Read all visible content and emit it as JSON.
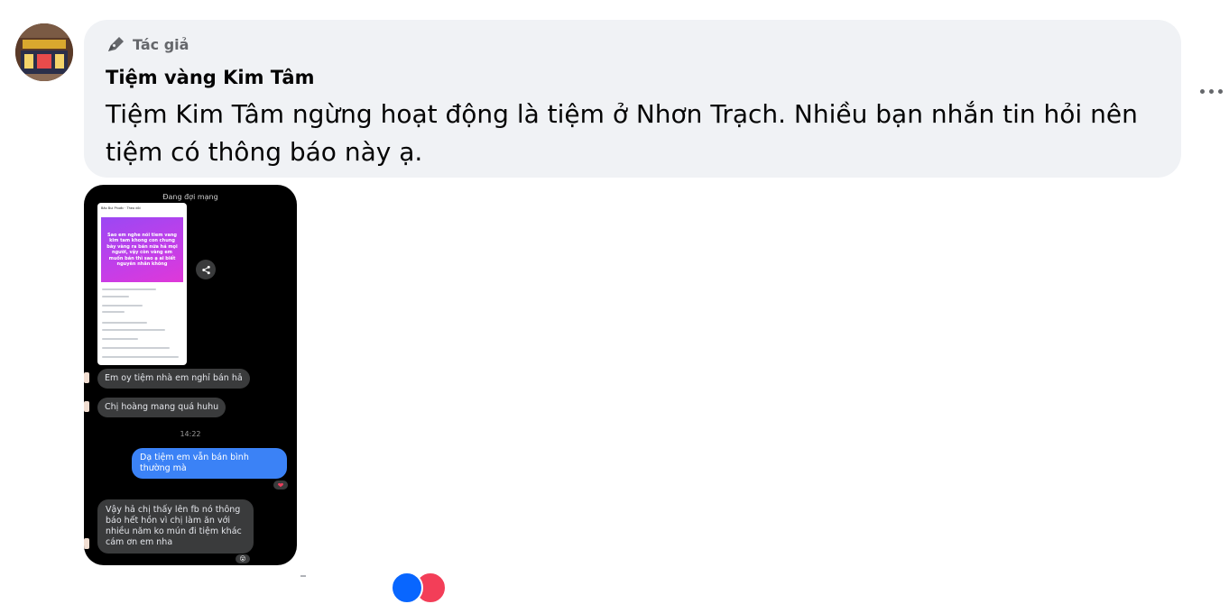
{
  "comment": {
    "badge_label": "Tác giả",
    "author_name": "Tiệm vàng Kim Tâm",
    "message": "Tiệm Kim Tâm ngừng hoạt động là tiệm ở Nhơn Trạch. Nhiều bạn nhắn tin hỏi nên tiệm có thông báo này ạ.",
    "badge_icon": "pen-icon",
    "more_icon": "more-options-icon"
  },
  "screenshot": {
    "status_text": "Đang đợi mạng",
    "post_header": "Bảo Bui Phước · Theo dõi",
    "post_card_text": "Sao em nghe nói tiem vang kim tam khong con chung bày vàng ra bán nữa hả mọi người, vậy còn vàng em muốn bán thì sao ạ ai biết nguyên nhân không",
    "messages": [
      {
        "text": "Em oy tiệm nhà em nghỉ bán hả",
        "side": "left"
      },
      {
        "text": "Chị hoàng mang quá huhu",
        "side": "left"
      },
      {
        "text": "Dạ tiệm em vẫn bán bình thường mà",
        "side": "right"
      },
      {
        "text": "Vậy hả chị thấy lên fb nó thông báo hết hồn vì chị làm ăn với nhiều năm ko mún đi tiệm khác cám ơn em nha",
        "side": "left"
      }
    ],
    "time_label": "14:22",
    "heart_reaction": "❤",
    "wow_reaction": "😮"
  },
  "reactions": {
    "like_color": "#0866ff",
    "love_color": "#f33e58"
  },
  "colors": {
    "bubble_bg": "#f0f2f5",
    "text": "#050505",
    "muted": "#65676b"
  }
}
